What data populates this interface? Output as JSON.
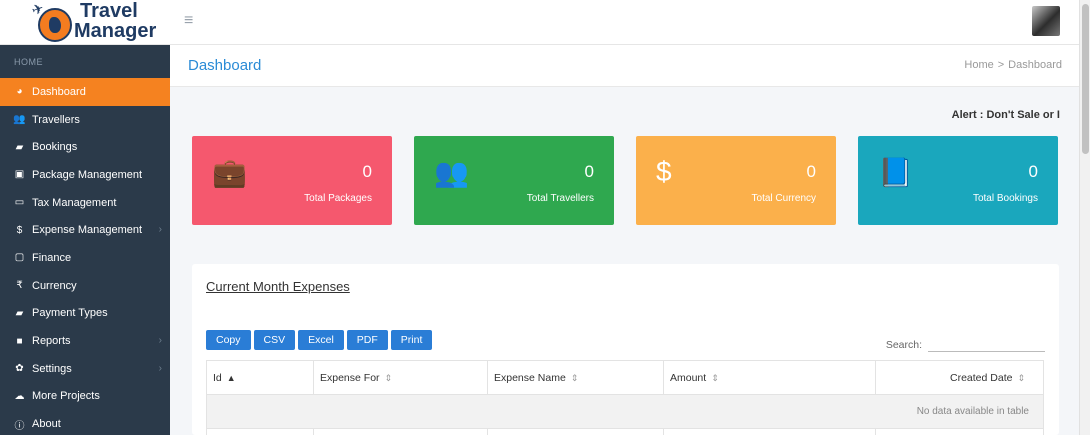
{
  "logo": {
    "line1": "Travel",
    "line2": "Manager"
  },
  "sidebar": {
    "heading": "HOME",
    "items": [
      {
        "label": "Dashboard",
        "icon": "dashboard-icon",
        "glyph": "◕",
        "active": true,
        "arrow": false
      },
      {
        "label": "Travellers",
        "icon": "users-icon",
        "glyph": "👥",
        "active": false,
        "arrow": false
      },
      {
        "label": "Bookings",
        "icon": "book-icon",
        "glyph": "▰",
        "active": false,
        "arrow": false
      },
      {
        "label": "Package Management",
        "icon": "briefcase-icon",
        "glyph": "▣",
        "active": false,
        "arrow": false
      },
      {
        "label": "Tax Management",
        "icon": "credit-card-icon",
        "glyph": "▭",
        "active": false,
        "arrow": false
      },
      {
        "label": "Expense Management",
        "icon": "dollar-icon",
        "glyph": "$",
        "active": false,
        "arrow": true
      },
      {
        "label": "Finance",
        "icon": "money-icon",
        "glyph": "▢",
        "active": false,
        "arrow": false
      },
      {
        "label": "Currency",
        "icon": "rupee-icon",
        "glyph": "₹",
        "active": false,
        "arrow": false
      },
      {
        "label": "Payment Types",
        "icon": "book-icon",
        "glyph": "▰",
        "active": false,
        "arrow": false
      },
      {
        "label": "Reports",
        "icon": "report-icon",
        "glyph": "■",
        "active": false,
        "arrow": true
      },
      {
        "label": "Settings",
        "icon": "gear-icon",
        "glyph": "✿",
        "active": false,
        "arrow": true
      },
      {
        "label": "More Projects",
        "icon": "cloud-icon",
        "glyph": "☁",
        "active": false,
        "arrow": false
      },
      {
        "label": "About",
        "icon": "info-icon",
        "glyph": "ⓘ",
        "active": false,
        "arrow": false
      }
    ]
  },
  "header": {
    "page_title": "Dashboard",
    "breadcrumb_home": "Home",
    "breadcrumb_sep": ">",
    "breadcrumb_current": "Dashboard",
    "alert": "Alert : Don't Sale or I"
  },
  "cards": [
    {
      "count": "0",
      "label": "Total Packages",
      "icon": "briefcase-icon",
      "glyph": "💼",
      "color": "#f5586e"
    },
    {
      "count": "0",
      "label": "Total Travellers",
      "icon": "users-icon",
      "glyph": "👥",
      "color": "#2fa84f"
    },
    {
      "count": "0",
      "label": "Total Currency",
      "icon": "dollar-icon",
      "glyph": "$",
      "color": "#fbb04b"
    },
    {
      "count": "0",
      "label": "Total Bookings",
      "icon": "book-icon",
      "glyph": "📘",
      "color": "#1aa7bd"
    }
  ],
  "expenses": {
    "title": "Current Month Expenses",
    "buttons": [
      "Copy",
      "CSV",
      "Excel",
      "PDF",
      "Print"
    ],
    "search_label": "Search:",
    "columns": [
      "Id",
      "Expense For",
      "Expense Name",
      "Amount",
      "Created Date"
    ],
    "empty_message": "No data available in table"
  }
}
